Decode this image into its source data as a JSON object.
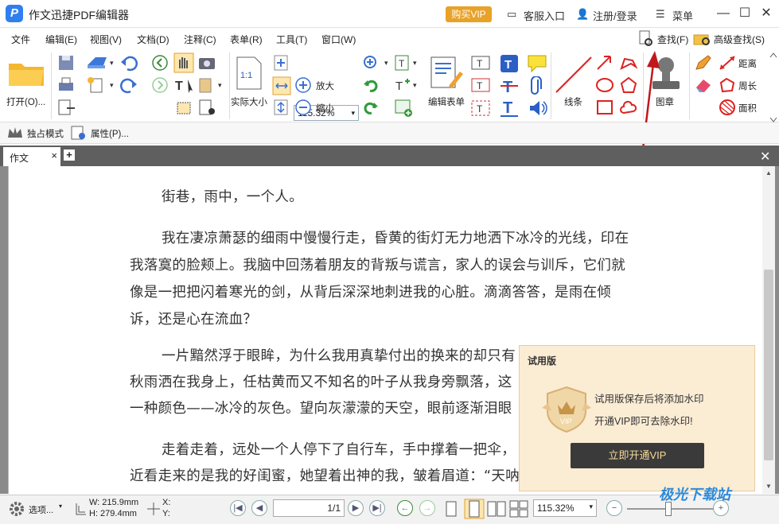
{
  "app": {
    "title": "作文迅捷PDF编辑器",
    "vip": "购买VIP",
    "service": "客服入口",
    "login": "注册/登录",
    "menu": "菜单"
  },
  "menubar": [
    "文件",
    "编辑(E)",
    "视图(V)",
    "文档(D)",
    "注释(C)",
    "表单(R)",
    "工具(T)",
    "窗口(W)"
  ],
  "search": {
    "find": "查找(F)",
    "advanced": "高级查找(S)"
  },
  "ribbon": {
    "open": "打开(O)...",
    "actual_size": "实际大小",
    "zoom": "115.32%",
    "zoom_in": "放大",
    "zoom_out": "缩小",
    "edit_form": "编辑表单",
    "line": "线条",
    "stamp": "图章",
    "distance": "距离",
    "perimeter": "周长",
    "area": "面积"
  },
  "subbar": {
    "exclusive": "独占模式",
    "properties": "属性(P)..."
  },
  "tab": {
    "name": "作文",
    "close": "×",
    "add": "+"
  },
  "doc": {
    "p1": "街巷，雨中，一个人。",
    "p2": "我在凄凉萧瑟的细雨中慢慢行走，昏黄的街灯无力地洒下冰冷的光线，印在我落寞的脸颊上。我脑中回荡着朋友的背叛与谎言，家人的误会与训斥，它们就像是一把把闪着寒光的剑，从背后深深地刺进我的心脏。滴滴答答，是雨在倾诉，还是心在流血？",
    "p3": "一片黯然浮于眼眸，为什么我用真挚付出的换来的却只有",
    "p3b": "秋雨洒在我身上，任枯黄而又不知名的叶子从我身旁飘落，这",
    "p3c": "一种颜色——冰冷的灰色。望向灰濛濛的天空，眼前逐渐泪眼",
    "p4": "走着走着，远处一个人停下了自行车，手中撑着一把伞，",
    "p4b": "近看走来的是我的好闺蜜，她望着出神的我，皱着眉道：“天呐，你疯了，谁映"
  },
  "popup": {
    "title": "试用版",
    "line1": "试用版保存后将添加水印",
    "line2": "开通VIP即可去除水印!",
    "button": "立即开通VIP",
    "badge": "VIP"
  },
  "status": {
    "options": "选项...",
    "w": "W: 215.9mm",
    "h": "H: 279.4mm",
    "x": "X:",
    "y": "Y:",
    "page": "1/1",
    "zoom": "115.32%"
  },
  "watermark": "极光下载站",
  "colors": {
    "accent": "#2f7ff0",
    "vip": "#e8a227",
    "arrow": "#c0181c"
  }
}
